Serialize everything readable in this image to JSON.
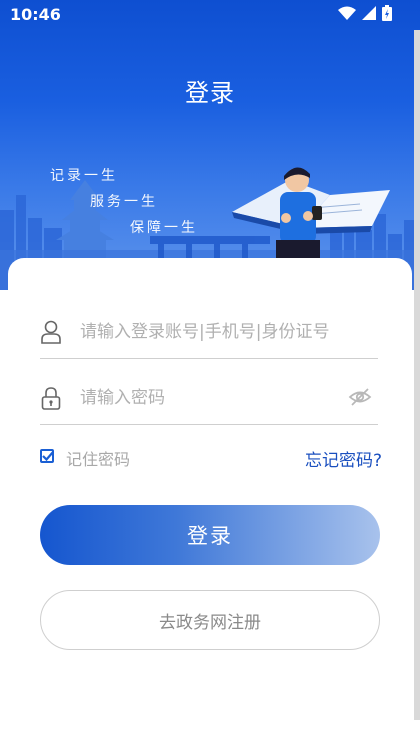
{
  "status_bar": {
    "time": "10:46"
  },
  "header": {
    "title": "登录"
  },
  "banner": {
    "slogans": [
      "记录一生",
      "服务一生",
      "保障一生"
    ]
  },
  "form": {
    "account_placeholder": "请输入登录账号|手机号|身份证号",
    "password_placeholder": "请输入密码",
    "remember_label": "记住密码",
    "remember_checked": true,
    "forgot_label": "忘记密码?"
  },
  "actions": {
    "login_label": "登录",
    "register_label": "去政务网注册"
  },
  "colors": {
    "brand": "#1556cf",
    "link": "#1a4fbf"
  }
}
